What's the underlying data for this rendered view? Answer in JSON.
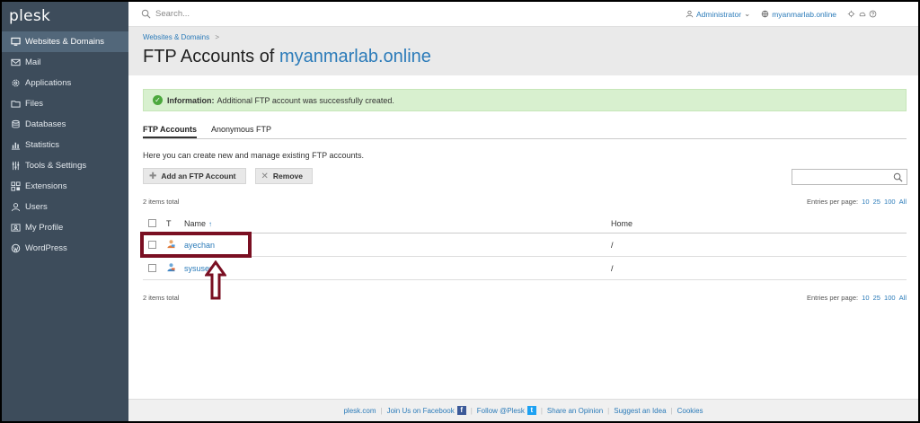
{
  "app": {
    "logo": "plesk"
  },
  "sidebar": {
    "items": [
      {
        "label": "Websites & Domains",
        "icon": "monitor-icon",
        "active": true
      },
      {
        "label": "Mail",
        "icon": "mail-icon"
      },
      {
        "label": "Applications",
        "icon": "gear-icon"
      },
      {
        "label": "Files",
        "icon": "folder-icon"
      },
      {
        "label": "Databases",
        "icon": "database-icon"
      },
      {
        "label": "Statistics",
        "icon": "bar-chart-icon"
      },
      {
        "label": "Tools & Settings",
        "icon": "sliders-icon"
      },
      {
        "label": "Extensions",
        "icon": "puzzle-icon"
      },
      {
        "label": "Users",
        "icon": "user-icon"
      },
      {
        "label": "My Profile",
        "icon": "profile-icon"
      },
      {
        "label": "WordPress",
        "icon": "wordpress-icon"
      }
    ]
  },
  "topbar": {
    "search_placeholder": "Search...",
    "user": "Administrator",
    "user_caret": "⌄",
    "domain": "myanmarlab.online"
  },
  "header": {
    "breadcrumb": "Websites & Domains",
    "breadcrumb_sep": ">",
    "title_prefix": "FTP Accounts of",
    "title_domain": "myanmarlab.online"
  },
  "info": {
    "label": "Information:",
    "message": "Additional FTP account was successfully created."
  },
  "tabs": [
    {
      "label": "FTP Accounts",
      "active": true
    },
    {
      "label": "Anonymous FTP"
    }
  ],
  "intro": "Here you can create new and manage existing FTP accounts.",
  "toolbar": {
    "add_label": "Add an FTP Account",
    "remove_label": "Remove"
  },
  "list": {
    "total": "2 items total",
    "entries_label": "Entries per page:",
    "page_sizes": [
      "10",
      "25",
      "100",
      "All"
    ],
    "columns": {
      "type": "T",
      "name": "Name",
      "sort": "↑",
      "home": "Home"
    },
    "rows": [
      {
        "name": "ayechan",
        "home": "/"
      },
      {
        "name": "sysuser",
        "home": "/"
      }
    ]
  },
  "footer": {
    "links": [
      "plesk.com",
      "Join Us on Facebook",
      "Follow @Plesk",
      "Share an Opinion",
      "Suggest an Idea",
      "Cookies"
    ]
  },
  "colors": {
    "sidebar": "#3d4c5b",
    "accent": "#2b7bb9",
    "success_bg": "#d8f0cf",
    "highlight": "#7a0f22"
  }
}
